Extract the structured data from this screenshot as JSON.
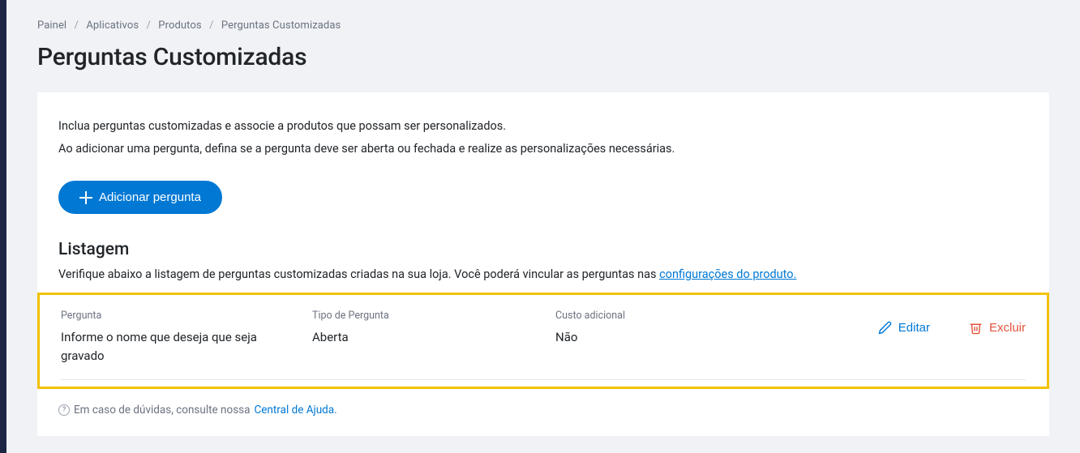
{
  "breadcrumb": {
    "items": [
      {
        "label": "Painel"
      },
      {
        "label": "Aplicativos"
      },
      {
        "label": "Produtos"
      }
    ],
    "current": "Perguntas Customizadas"
  },
  "page_title": "Perguntas Customizadas",
  "intro": {
    "line1": "Inclua perguntas customizadas e associe a produtos que possam ser personalizados.",
    "line2": "Ao adicionar uma pergunta, defina se a pergunta deve ser aberta ou fechada e realize as personalizações necessárias."
  },
  "add_button_label": "Adicionar pergunta",
  "listing": {
    "title": "Listagem",
    "description_prefix": "Verifique abaixo a listagem de perguntas customizadas criadas na sua loja. Você poderá vincular as perguntas nas ",
    "description_link": "configurações do produto."
  },
  "table": {
    "headers": {
      "question": "Pergunta",
      "type": "Tipo de Pergunta",
      "cost": "Custo adicional"
    },
    "rows": [
      {
        "question": "Informe o nome que deseja que seja gravado",
        "type": "Aberta",
        "cost": "Não"
      }
    ],
    "actions": {
      "edit": "Editar",
      "delete": "Excluir"
    }
  },
  "footer": {
    "text": "Em caso de dúvidas, consulte nossa ",
    "link": "Central de Ajuda."
  }
}
